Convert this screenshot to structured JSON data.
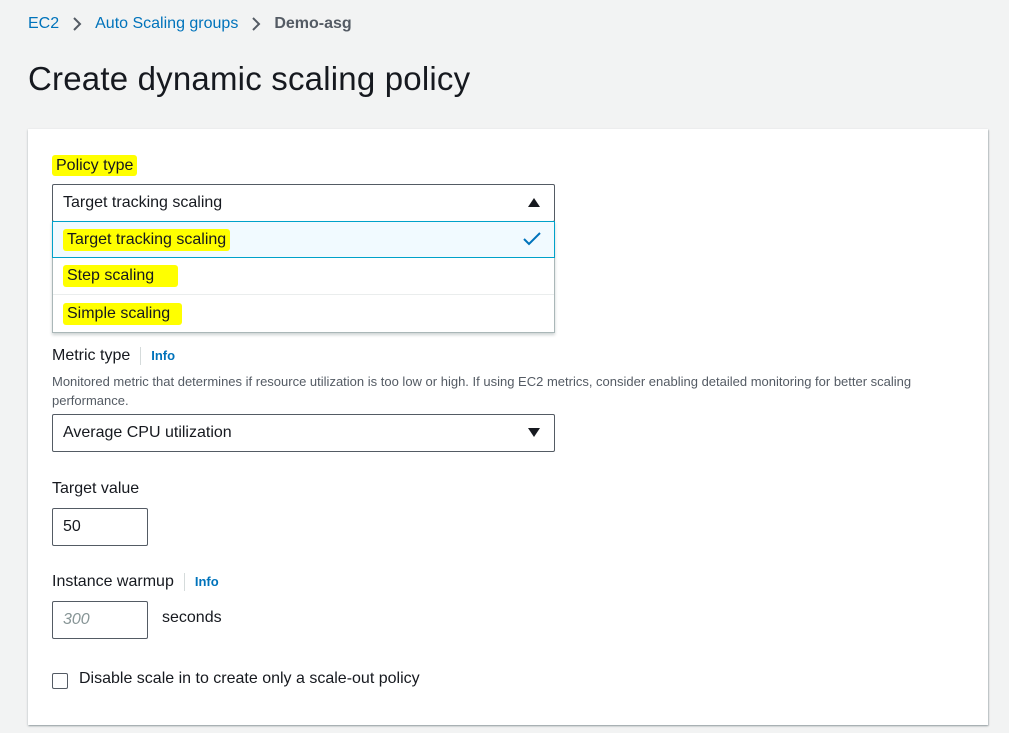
{
  "breadcrumb": {
    "items": [
      "EC2",
      "Auto Scaling groups"
    ],
    "current": "Demo-asg"
  },
  "page_title": "Create dynamic scaling policy",
  "policy_type": {
    "label": "Policy type",
    "selected": "Target tracking scaling",
    "options": [
      "Target tracking scaling",
      "Step scaling",
      "Simple scaling"
    ],
    "dropdown_open": true,
    "highlight_color": "#ffff00"
  },
  "metric_type": {
    "label": "Metric type",
    "info": "Info",
    "description": "Monitored metric that determines if resource utilization is too low or high. If using EC2 metrics, consider enabling detailed monitoring for better scaling performance.",
    "selected": "Average CPU utilization"
  },
  "target_value": {
    "label": "Target value",
    "value": "50"
  },
  "instance_warmup": {
    "label": "Instance warmup",
    "info": "Info",
    "placeholder": "300",
    "unit": "seconds"
  },
  "disable_scale_in": {
    "label": "Disable scale in to create only a scale-out policy",
    "checked": false
  },
  "colors": {
    "link": "#0073bb",
    "background": "#f2f3f3",
    "selected_option_bg": "#f1faff",
    "check": "#0073bb"
  }
}
